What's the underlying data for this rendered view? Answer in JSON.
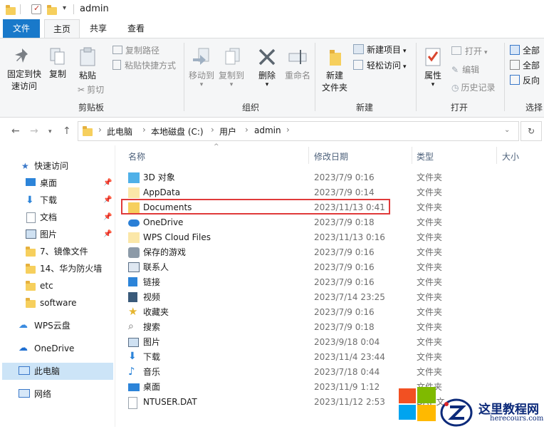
{
  "window": {
    "title": "admin"
  },
  "tabs": {
    "file": "文件",
    "home": "主页",
    "share": "共享",
    "view": "查看"
  },
  "ribbon": {
    "clipboard": {
      "pin": "固定到快\n速访问",
      "pin_l1": "固定到快",
      "pin_l2": "速访问",
      "copy": "复制",
      "paste": "粘贴",
      "copy_path": "复制路径",
      "paste_shortcut": "粘贴快捷方式",
      "cut": "剪切",
      "label": "剪贴板"
    },
    "organize": {
      "move_to": "移动到",
      "copy_to": "复制到",
      "delete": "删除",
      "rename": "重命名",
      "label": "组织"
    },
    "new": {
      "new_folder_l1": "新建",
      "new_folder_l2": "文件夹",
      "new_item": "新建项目",
      "easy_access": "轻松访问",
      "label": "新建"
    },
    "open": {
      "properties": "属性",
      "open": "打开",
      "edit": "编辑",
      "history": "历史记录",
      "label": "打开"
    },
    "select": {
      "select_all": "全部",
      "select_none": "全部",
      "invert": "反向",
      "label": "选择"
    }
  },
  "address": {
    "crumbs": [
      "此电脑",
      "本地磁盘 (C:)",
      "用户",
      "admin"
    ]
  },
  "nav": {
    "quick_access": "快速访问",
    "items": [
      "桌面",
      "下载",
      "文档",
      "图片",
      "7、镜像文件",
      "14、华为防火墙",
      "etc",
      "software"
    ],
    "wps": "WPS云盘",
    "onedrive": "OneDrive",
    "this_pc": "此电脑",
    "network": "网络"
  },
  "columns": {
    "name": "名称",
    "date": "修改日期",
    "type": "类型",
    "size": "大小"
  },
  "files": [
    {
      "name": "3D 对象",
      "date": "2023/7/9 0:16",
      "type": "文件夹",
      "icon": "3d-objects-icon"
    },
    {
      "name": "AppData",
      "date": "2023/7/9 0:14",
      "type": "文件夹",
      "icon": "folder-icon"
    },
    {
      "name": "Documents",
      "date": "2023/11/13 0:41",
      "type": "文件夹",
      "icon": "folder-icon"
    },
    {
      "name": "OneDrive",
      "date": "2023/7/9 0:18",
      "type": "文件夹",
      "icon": "onedrive-icon"
    },
    {
      "name": "WPS Cloud Files",
      "date": "2023/11/13 0:16",
      "type": "文件夹",
      "icon": "folder-icon"
    },
    {
      "name": "保存的游戏",
      "date": "2023/7/9 0:16",
      "type": "文件夹",
      "icon": "saved-games-icon"
    },
    {
      "name": "联系人",
      "date": "2023/7/9 0:16",
      "type": "文件夹",
      "icon": "contacts-icon"
    },
    {
      "name": "链接",
      "date": "2023/7/9 0:16",
      "type": "文件夹",
      "icon": "links-icon"
    },
    {
      "name": "视频",
      "date": "2023/7/14 23:25",
      "type": "文件夹",
      "icon": "videos-icon"
    },
    {
      "name": "收藏夹",
      "date": "2023/7/9 0:16",
      "type": "文件夹",
      "icon": "favorites-icon"
    },
    {
      "name": "搜索",
      "date": "2023/7/9 0:18",
      "type": "文件夹",
      "icon": "searches-icon"
    },
    {
      "name": "图片",
      "date": "2023/9/18 0:04",
      "type": "文件夹",
      "icon": "pictures-icon"
    },
    {
      "name": "下载",
      "date": "2023/11/4 23:44",
      "type": "文件夹",
      "icon": "downloads-icon"
    },
    {
      "name": "音乐",
      "date": "2023/7/18 0:44",
      "type": "文件夹",
      "icon": "music-icon"
    },
    {
      "name": "桌面",
      "date": "2023/11/9 1:12",
      "type": "文件夹",
      "icon": "desktop-icon"
    },
    {
      "name": "NTUSER.DAT",
      "date": "2023/11/12 2:53",
      "type": "DAT 文",
      "icon": "file-icon"
    }
  ],
  "watermark": {
    "text": "这里教程网",
    "url": "herecours.com"
  },
  "colors": {
    "accent": "#1979ca",
    "highlight": "#e03a3a",
    "folder": "#f6cf5d"
  }
}
